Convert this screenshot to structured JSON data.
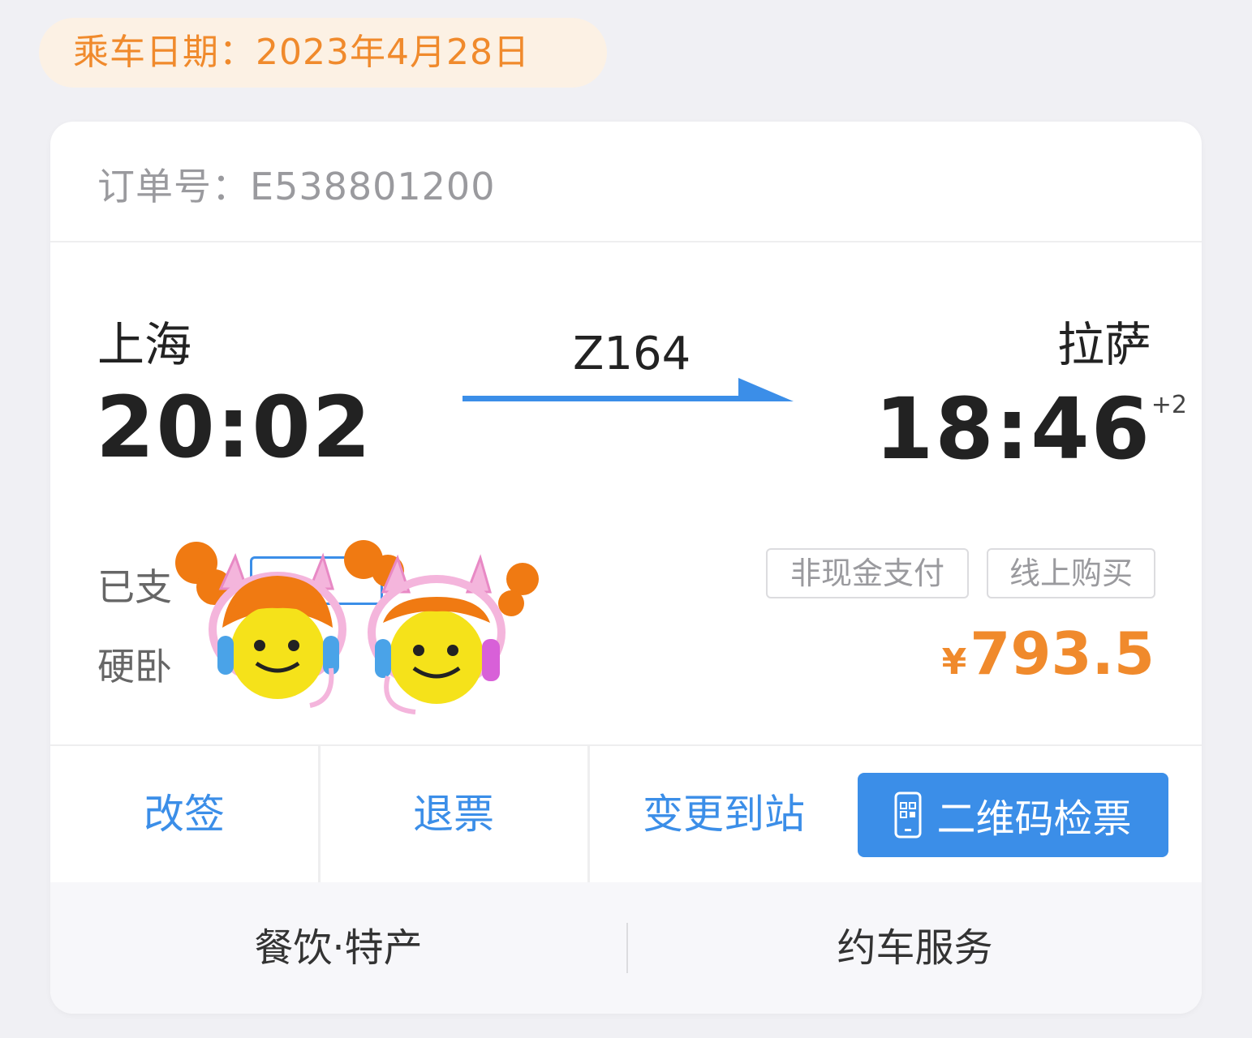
{
  "trip_date": "乘车日期：2023年4月28日",
  "order": {
    "label": "订单号：E538801200"
  },
  "route": {
    "from_city": "上海",
    "from_time": "20:02",
    "to_city": "拉萨",
    "to_time": "18:46",
    "day_offset": "+2",
    "train_no": "Z164"
  },
  "ticket": {
    "paid_status": "已支",
    "seat_type": "硬卧",
    "seat_tag": "",
    "tags": [
      "非现金支付",
      "线上购买"
    ],
    "currency": "¥",
    "price": "793.5"
  },
  "actions": {
    "change": "改签",
    "refund": "退票",
    "change_station": "变更到站",
    "qr_check": "二维码检票"
  },
  "services": {
    "food": "餐饮·特产",
    "car": "约车服务"
  },
  "colors": {
    "accent": "#3b8ee8",
    "price": "#f08a2c",
    "date_pill_bg": "#fcf1e4"
  }
}
